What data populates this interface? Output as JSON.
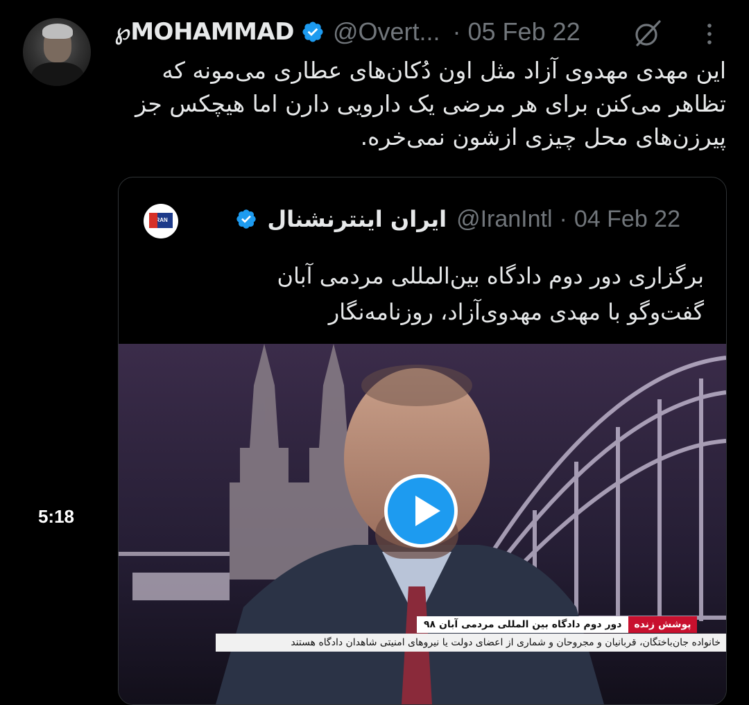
{
  "tweet": {
    "author_name": "MOHAMMAD",
    "name_prefix_glyph": "℘",
    "handle": "@Overt...",
    "separator": "·",
    "date": "05 Feb 22",
    "text": "این مهدی مهدوی آزاد مثل اون دُکان‌های عطاری می‌مونه که تظاهر می‌کنن برای هر مرضی یک دارویی دارن اما هیچکس جز پیرزن‌های محل چیزی ازشون نمی‌خره."
  },
  "quoted_tweet": {
    "author_name": "ایران اینترنشنال",
    "handle": "@IranIntl",
    "separator": "·",
    "date": "04 Feb 22",
    "logo_text": "IRAN",
    "text_line1": "برگزاری دور دوم دادگاه بین‌المللی مردمی آبان",
    "text_line2": "گفت‌وگو با مهدی مهدوی‌آزاد، روزنامه‌نگار",
    "video": {
      "duration": "5:18",
      "ticker_live": "پوشش زنده",
      "ticker_title": "دور دوم دادگاه بین المللی مردمی آبان ۹۸",
      "ticker_sub": "خانواده جان‌باختگان، قربانیان و مجروحان و شماری از اعضای دولت یا نیروهای امنیتی شاهدان دادگاه هستند"
    }
  },
  "colors": {
    "background": "#000000",
    "text": "#e7e9ea",
    "secondary": "#71767b",
    "verified": "#1d9bf0",
    "border": "#2f3336"
  },
  "icons": [
    "verified-badge-icon",
    "grok-icon",
    "more-icon",
    "play-icon"
  ]
}
